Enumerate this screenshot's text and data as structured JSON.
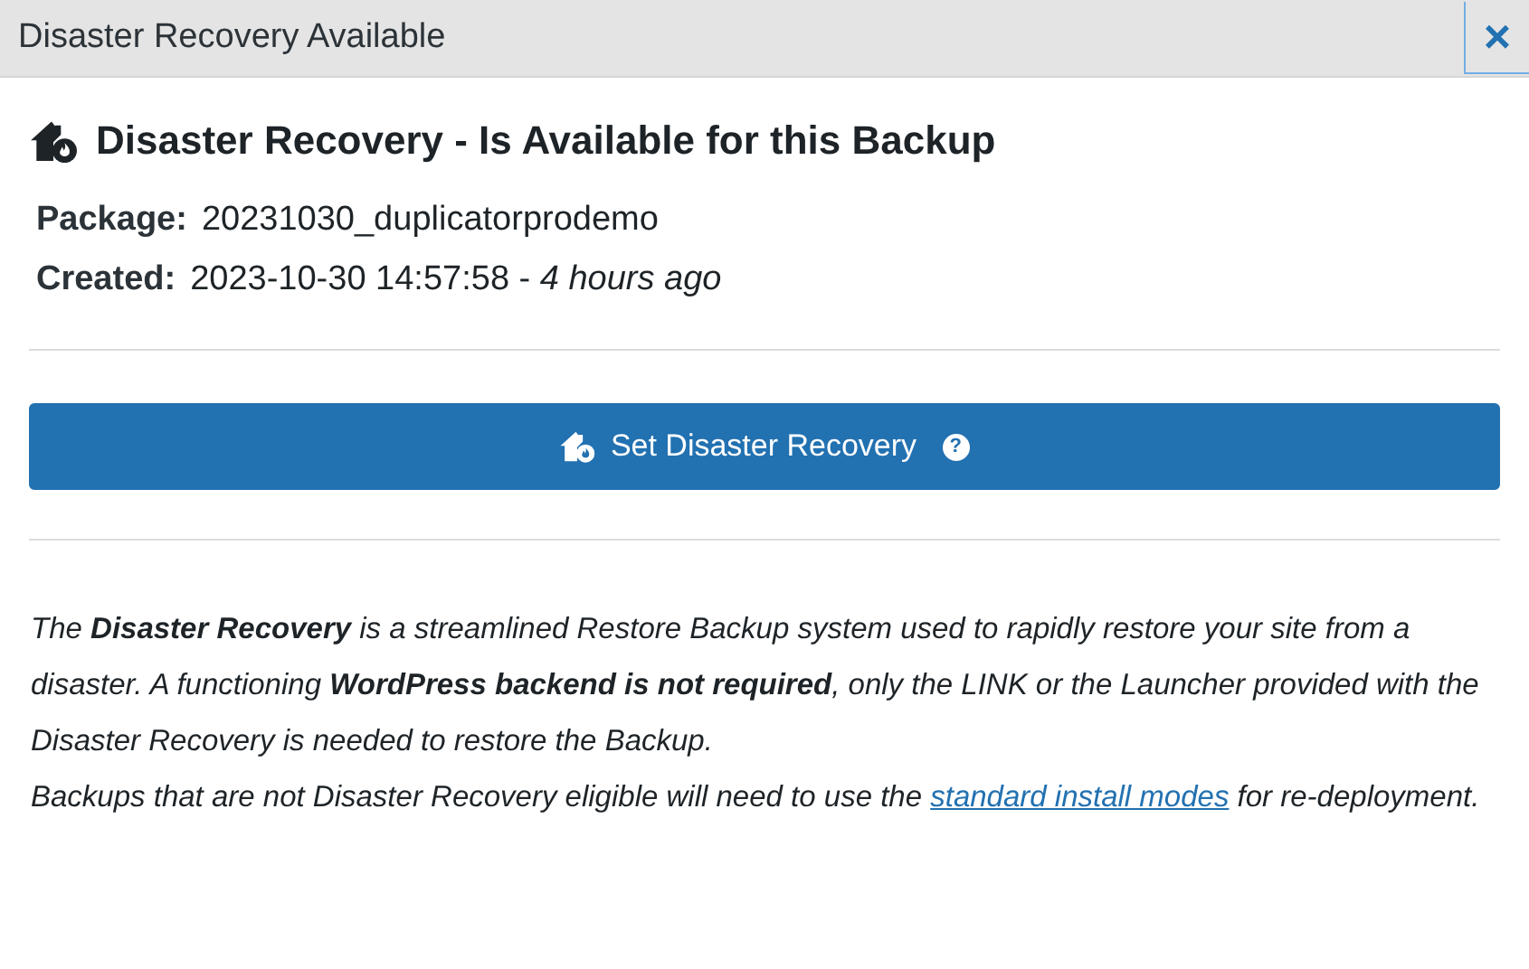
{
  "window": {
    "title": "Disaster Recovery Available",
    "close": "×"
  },
  "heading": "Disaster Recovery - Is Available for this Backup",
  "details": [
    {
      "label": "Package:",
      "value": "20231030_duplicatorprodemo"
    },
    {
      "label": "Created:",
      "value": "2023-10-30 14:57:58 - *4 hours ago*"
    }
  ],
  "button": {
    "label": "Set Disaster Recovery",
    "help": "?"
  },
  "description": {
    "paragraph": "The **Disaster Recovery** is a streamlined Restore Backup system used to rapidly restore your site from a disaster. A functioning **WordPress backend is not required**, only the LINK or the Launcher provided with the Disaster Recovery is needed to restore the Backup.",
    "note_before": "Backups that are not Disaster Recovery eligible will need to use the",
    "link": "standard install modes",
    "note_after": "for re-deployment."
  }
}
